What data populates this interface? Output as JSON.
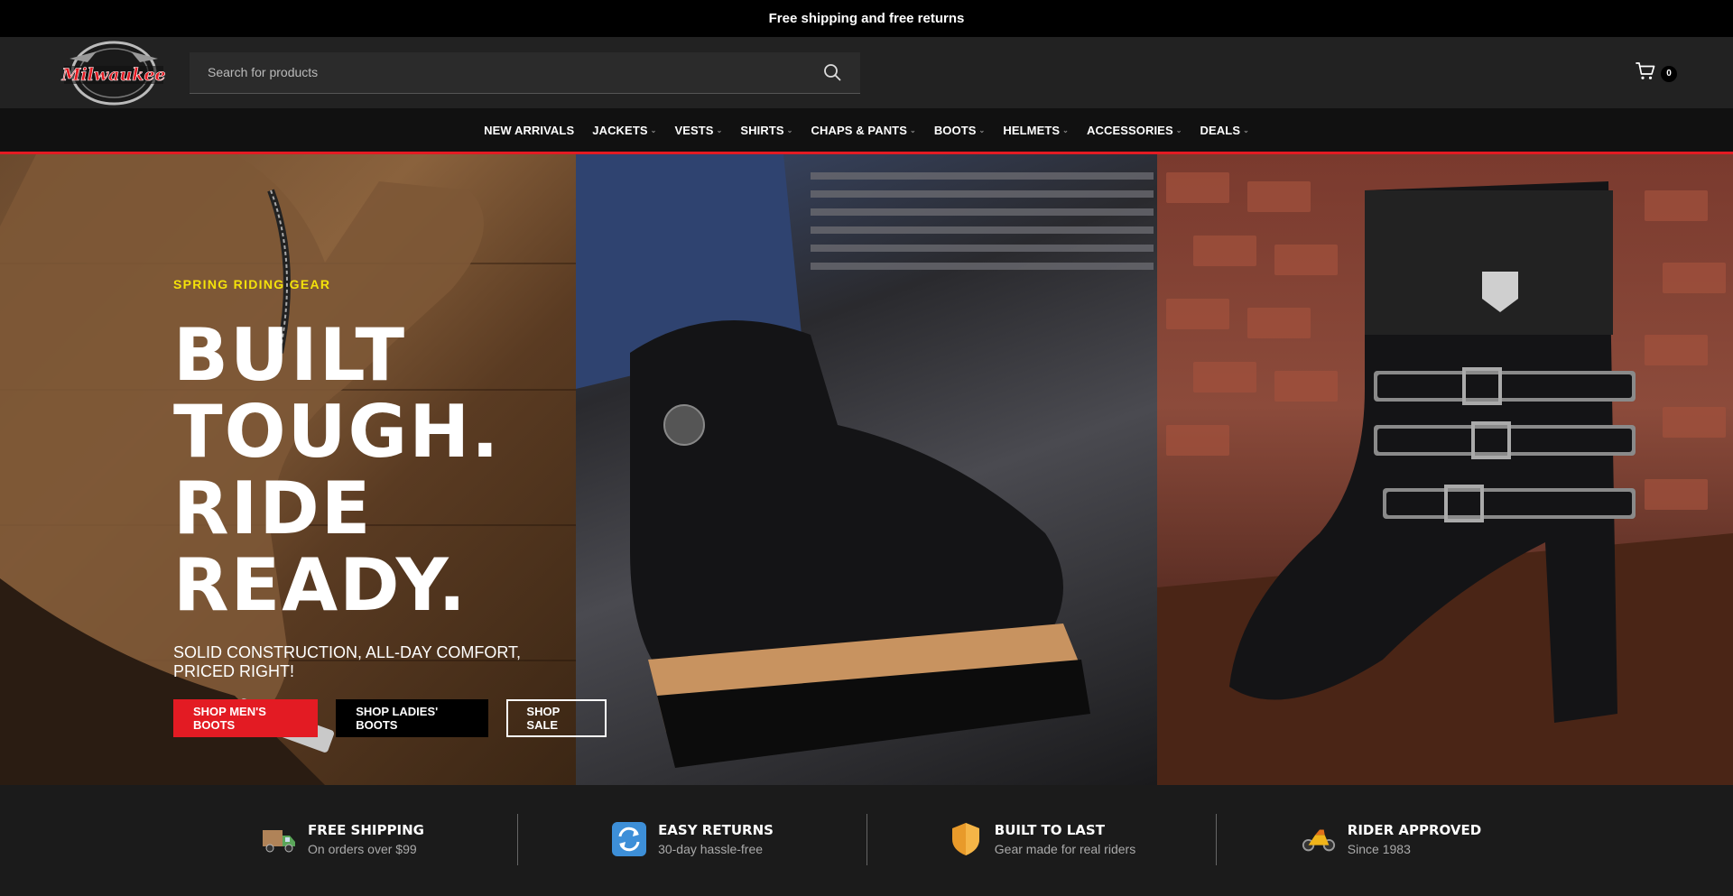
{
  "announcement": "Free shipping and free returns",
  "header": {
    "logo_text": "Milwaukee",
    "search_placeholder": "Search for products",
    "cart_count": "0"
  },
  "nav": [
    {
      "label": "NEW ARRIVALS",
      "dropdown": false
    },
    {
      "label": "JACKETS",
      "dropdown": true
    },
    {
      "label": "VESTS",
      "dropdown": true
    },
    {
      "label": "SHIRTS",
      "dropdown": true
    },
    {
      "label": "CHAPS & PANTS",
      "dropdown": true
    },
    {
      "label": "BOOTS",
      "dropdown": true
    },
    {
      "label": "HELMETS",
      "dropdown": true
    },
    {
      "label": "ACCESSORIES",
      "dropdown": true
    },
    {
      "label": "DEALS",
      "dropdown": true
    }
  ],
  "hero": {
    "eyebrow": "SPRING RIDING GEAR",
    "headline": "BUILT\nTOUGH. RIDE\nREADY.",
    "subline": "SOLID CONSTRUCTION, ALL-DAY COMFORT, PRICED RIGHT!",
    "buttons": {
      "mens": "SHOP MEN'S BOOTS",
      "ladies": "SHOP LADIES' BOOTS",
      "sale": "SHOP SALE"
    }
  },
  "features": [
    {
      "icon": "truck-icon",
      "title": "FREE SHIPPING",
      "sub": "On orders over $99"
    },
    {
      "icon": "returns-icon",
      "title": "EASY RETURNS",
      "sub": "30-day hassle-free"
    },
    {
      "icon": "shield-icon",
      "title": "BUILT TO LAST",
      "sub": "Gear made for real riders"
    },
    {
      "icon": "motorcycle-icon",
      "title": "RIDER APPROVED",
      "sub": "Since 1983"
    }
  ],
  "colors": {
    "accent_red": "#e31b23",
    "eyebrow_yellow": "#f4e20a",
    "header_bg": "#222222",
    "nav_bg": "#111111"
  }
}
